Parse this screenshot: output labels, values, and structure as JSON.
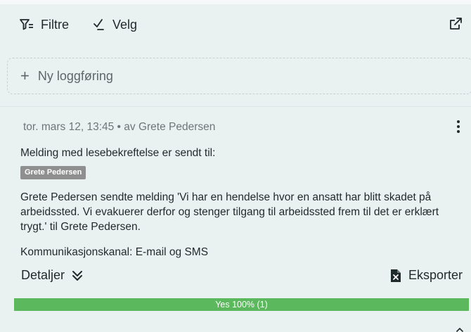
{
  "toolbar": {
    "filter_label": "Filtre",
    "select_label": "Velg"
  },
  "new_entry": {
    "label": "Ny loggføring"
  },
  "entry": {
    "meta": "tor. mars 12, 13:45 • av Grete Pedersen",
    "read_receipt_text": "Melding med lesebekreftelse er sendt til:",
    "recipient": "Grete Pedersen",
    "message": "Grete Pedersen sendte melding 'Vi har en hendelse hvor en ansatt har blitt skadet på arbeidssted. Vi evakuerer derfor og stenger tilgang til arbeidssted frem til det er erklært trygt.' til Grete Pedersen.",
    "channel": "Kommunikasjonskanal: E-mail og SMS",
    "details_label": "Detaljer",
    "export_label": "Eksporter",
    "progress": {
      "label": "Yes 100% (1)",
      "fraction": 1.0,
      "color": "#5cb85c"
    }
  },
  "icons": {
    "filter": "filter-icon",
    "select": "check-icon",
    "external": "external-link-icon",
    "add": "plus-icon",
    "menu": "more-vertical-icon",
    "details": "double-chevron-down-icon",
    "export": "file-export-icon"
  }
}
